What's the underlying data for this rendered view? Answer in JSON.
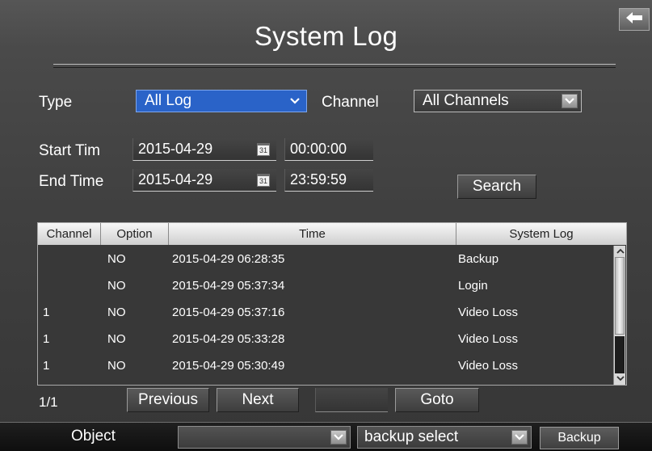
{
  "window": {
    "title": "System Log"
  },
  "filters": {
    "type_label": "Type",
    "type_value": "All Log",
    "channel_label": "Channel",
    "channel_value": "All Channels",
    "start_label": "Start Tim",
    "start_date": "2015-04-29",
    "start_time": "00:00:00",
    "end_label": "End Time",
    "end_date": "2015-04-29",
    "end_time": "23:59:59",
    "calendar_glyph": "31",
    "search_label": "Search"
  },
  "table": {
    "headers": [
      "Channel",
      "Option",
      "Time",
      "System Log"
    ],
    "rows": [
      {
        "channel": "",
        "option": "NO",
        "time": "2015-04-29 06:28:35",
        "log": "Backup"
      },
      {
        "channel": "",
        "option": "NO",
        "time": "2015-04-29 05:37:34",
        "log": "Login"
      },
      {
        "channel": "1",
        "option": "NO",
        "time": "2015-04-29 05:37:16",
        "log": "Video Loss"
      },
      {
        "channel": "1",
        "option": "NO",
        "time": "2015-04-29 05:33:28",
        "log": "Video Loss"
      },
      {
        "channel": "1",
        "option": "NO",
        "time": "2015-04-29 05:30:49",
        "log": "Video Loss"
      }
    ]
  },
  "pagination": {
    "page": "1/1",
    "previous_label": "Previous",
    "next_label": "Next",
    "goto_value": "",
    "goto_label": "Goto"
  },
  "footer": {
    "object_label": "Object",
    "object_value": "",
    "backup_select_value": "backup select",
    "backup_label": "Backup"
  },
  "colors": {
    "accent": "#2a63c8",
    "background": "#444444",
    "header_row": "#e6e6e6"
  },
  "icons": [
    "back-arrow-icon",
    "chevron-down-icon",
    "calendar-icon",
    "scroll-up-icon",
    "scroll-down-icon"
  ]
}
